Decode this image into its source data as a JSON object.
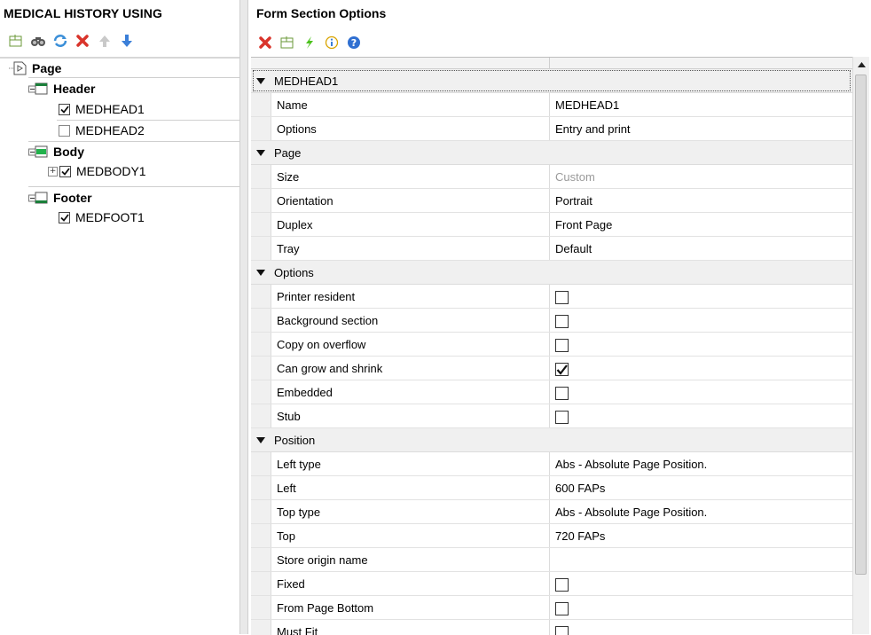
{
  "left_panel": {
    "title": "MEDICAL HISTORY USING",
    "toolbar": [
      {
        "name": "add-section-icon"
      },
      {
        "name": "find-icon"
      },
      {
        "name": "refresh-icon"
      },
      {
        "name": "delete-icon"
      },
      {
        "name": "move-up-icon"
      },
      {
        "name": "move-down-icon"
      }
    ],
    "tree": {
      "page_label": "Page",
      "header_label": "Header",
      "header_items": [
        {
          "label": "MEDHEAD1",
          "checked": true
        },
        {
          "label": "MEDHEAD2",
          "checked": false
        }
      ],
      "body_label": "Body",
      "body_items": [
        {
          "label": "MEDBODY1",
          "checked": true
        }
      ],
      "footer_label": "Footer",
      "footer_items": [
        {
          "label": "MEDFOOT1",
          "checked": true
        }
      ]
    }
  },
  "right_panel": {
    "title": "Form Section Options",
    "toolbar": [
      {
        "name": "delete-icon"
      },
      {
        "name": "add-section-icon"
      },
      {
        "name": "lightning-icon"
      },
      {
        "name": "info-icon"
      },
      {
        "name": "help-icon"
      }
    ],
    "grid": {
      "categories": [
        {
          "title": "MEDHEAD1",
          "rows": [
            {
              "name": "Name",
              "value": "MEDHEAD1"
            },
            {
              "name": "Options",
              "value": "Entry and print"
            }
          ]
        },
        {
          "title": "Page",
          "rows": [
            {
              "name": "Size",
              "value": "Custom",
              "muted": true
            },
            {
              "name": "Orientation",
              "value": "Portrait"
            },
            {
              "name": "Duplex",
              "value": "Front Page"
            },
            {
              "name": "Tray",
              "value": "Default"
            }
          ]
        },
        {
          "title": "Options",
          "rows": [
            {
              "name": "Printer resident",
              "checkbox": true,
              "checked": false
            },
            {
              "name": "Background section",
              "checkbox": true,
              "checked": false
            },
            {
              "name": "Copy on overflow",
              "checkbox": true,
              "checked": false
            },
            {
              "name": "Can grow and shrink",
              "checkbox": true,
              "checked": true
            },
            {
              "name": "Embedded",
              "checkbox": true,
              "checked": false
            },
            {
              "name": "Stub",
              "checkbox": true,
              "checked": false
            }
          ]
        },
        {
          "title": "Position",
          "rows": [
            {
              "name": "Left type",
              "value": "Abs - Absolute Page Position."
            },
            {
              "name": "Left",
              "value": "600 FAPs"
            },
            {
              "name": "Top type",
              "value": "Abs - Absolute Page Position."
            },
            {
              "name": "Top",
              "value": "720 FAPs"
            },
            {
              "name": "Store origin name",
              "value": ""
            },
            {
              "name": "Fixed",
              "checkbox": true,
              "checked": false
            },
            {
              "name": "From Page Bottom",
              "checkbox": true,
              "checked": false
            },
            {
              "name": "Must Fit",
              "checkbox": true,
              "checked": false
            }
          ]
        }
      ]
    }
  },
  "colors": {
    "header_icon": "#1a7f3a",
    "body_icon": "#22b24c",
    "delete_red": "#d9342b",
    "arrow_blue": "#3b7fd8"
  }
}
